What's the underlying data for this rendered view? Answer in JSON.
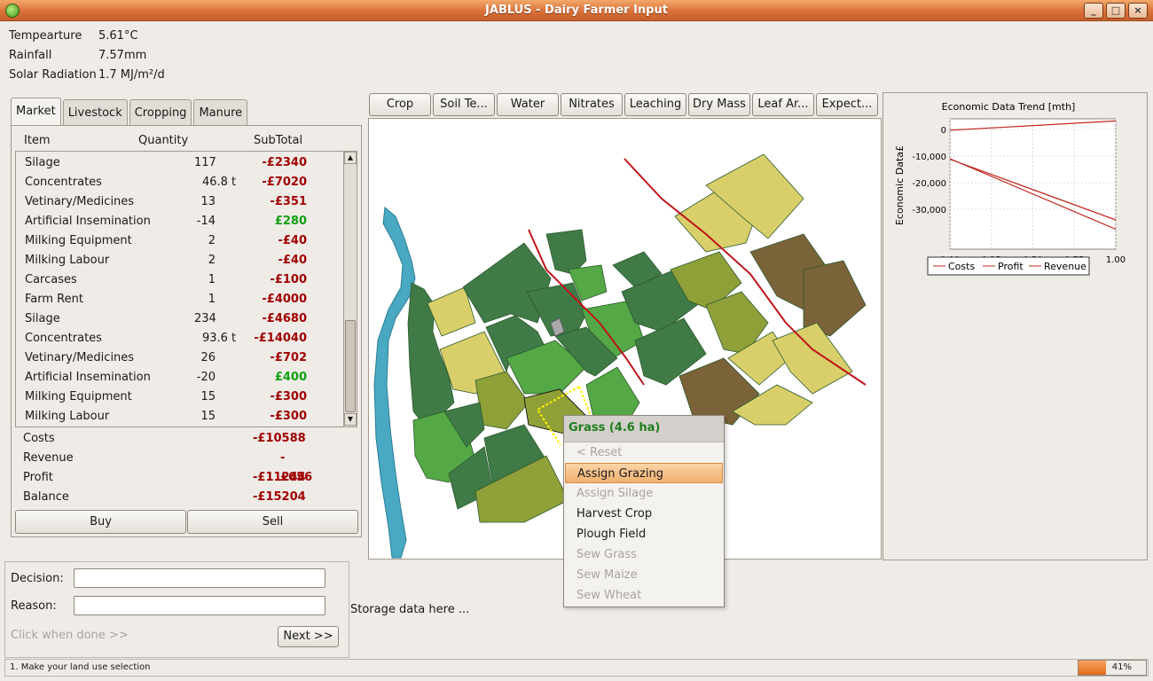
{
  "window": {
    "title": "JABLUS - Dairy Farmer Input",
    "buttons": [
      "_",
      "□",
      "×"
    ]
  },
  "weather": [
    {
      "label": "Tempearture",
      "value": "5.61°C"
    },
    {
      "label": "Rainfall",
      "value": "7.57mm"
    },
    {
      "label": "Solar Radiation",
      "value": "1.7  MJ/m²/d"
    }
  ],
  "tabs": [
    "Market",
    "Livestock",
    "Cropping",
    "Manure"
  ],
  "market": {
    "headers": {
      "item": "Item",
      "quantity": "Quantity",
      "subtotal": "SubTotal"
    },
    "rows": [
      {
        "item": "Silage",
        "qty": "117",
        "unit": "",
        "subtotal": "-£2340",
        "positive": false
      },
      {
        "item": "Concentrates",
        "qty": "46.8",
        "unit": "t",
        "subtotal": "-£7020",
        "positive": false
      },
      {
        "item": "Vetinary/Medicines",
        "qty": "13",
        "unit": "",
        "subtotal": "-£351",
        "positive": false
      },
      {
        "item": "Artificial Insemination",
        "qty": "-14",
        "unit": "",
        "subtotal": "£280",
        "positive": true
      },
      {
        "item": "Milking Equipment",
        "qty": "2",
        "unit": "",
        "subtotal": "-£40",
        "positive": false
      },
      {
        "item": "Milking Labour",
        "qty": "2",
        "unit": "",
        "subtotal": "-£40",
        "positive": false
      },
      {
        "item": "Carcases",
        "qty": "1",
        "unit": "",
        "subtotal": "-£100",
        "positive": false
      },
      {
        "item": "Farm Rent",
        "qty": "1",
        "unit": "",
        "subtotal": "-£4000",
        "positive": false
      },
      {
        "item": "Silage",
        "qty": "234",
        "unit": "",
        "subtotal": "-£4680",
        "positive": false
      },
      {
        "item": "Concentrates",
        "qty": "93.6",
        "unit": "t",
        "subtotal": "-£14040",
        "positive": false
      },
      {
        "item": "Vetinary/Medicines",
        "qty": "26",
        "unit": "",
        "subtotal": "-£702",
        "positive": false
      },
      {
        "item": "Artificial Insemination",
        "qty": "-20",
        "unit": "",
        "subtotal": "£400",
        "positive": true
      },
      {
        "item": "Milking Equipment",
        "qty": "15",
        "unit": "",
        "subtotal": "-£300",
        "positive": false
      },
      {
        "item": "Milking Labour",
        "qty": "15",
        "unit": "",
        "subtotal": "-£300",
        "positive": false
      }
    ],
    "summary": [
      {
        "label": "Costs",
        "value": "-£10588"
      },
      {
        "label": "Revenue",
        "value": "-£656"
      },
      {
        "label": "Profit",
        "value": "-£11244"
      },
      {
        "label": "Balance",
        "value": "-£15204"
      }
    ],
    "buy_label": "Buy",
    "sell_label": "Sell"
  },
  "toolbar": [
    "Crop",
    "Soil Te...",
    "Water",
    "Nitrates",
    "Leaching",
    "Dry Mass",
    "Leaf Ar...",
    "Expect..."
  ],
  "context_menu": {
    "title": "Grass (4.6 ha)",
    "items": [
      {
        "label": "< Reset",
        "enabled": false
      },
      {
        "label": "Assign Grazing",
        "enabled": true,
        "highlighted": true
      },
      {
        "label": "Assign Silage",
        "enabled": false
      },
      {
        "label": "Harvest Crop",
        "enabled": true
      },
      {
        "label": "Plough Field",
        "enabled": true
      },
      {
        "label": "Sew Grass",
        "enabled": false
      },
      {
        "label": "Sew Maize",
        "enabled": false
      },
      {
        "label": "Sew Wheat",
        "enabled": false
      }
    ]
  },
  "chart_data": {
    "type": "line",
    "title": "Economic Data Trend [mth]",
    "xlabel": "",
    "ylabel": "Economic Data£",
    "xlim": [
      0,
      1
    ],
    "ylim": [
      -45000,
      4000
    ],
    "xticks": [
      "0.00",
      "0.25",
      "0.50",
      "0.75",
      "1.00"
    ],
    "yticks": [
      {
        "value": 0,
        "label": "0"
      },
      {
        "value": -10000,
        "label": "-10,000"
      },
      {
        "value": -20000,
        "label": "-20,000"
      },
      {
        "value": -30000,
        "label": "-30,000"
      }
    ],
    "series": [
      {
        "name": "Costs",
        "x": [
          0,
          1
        ],
        "y": [
          -11000,
          -37500
        ]
      },
      {
        "name": "Profit",
        "x": [
          0,
          1
        ],
        "y": [
          -11200,
          -34000
        ]
      },
      {
        "name": "Revenue",
        "x": [
          0,
          1
        ],
        "y": [
          -300,
          3200
        ]
      }
    ],
    "line_color": "#c0281e",
    "legend_position": "bottom",
    "grid": true
  },
  "decision": {
    "decision_label": "Decision:",
    "reason_label": "Reason:",
    "decision_value": "",
    "reason_value": "",
    "hint": "Click when done >>",
    "next_label": "Next >>"
  },
  "storage_text": "Storage data here ...",
  "status": {
    "message": "1. Make your land use selection",
    "progress": 41,
    "progress_text": "41%"
  },
  "map_colors": {
    "dark": "#3f7a47",
    "mid": "#54a845",
    "light": "#d9cf6a",
    "olive": "#8fa039",
    "brown": "#7a6239",
    "water": "#4aa9c2",
    "road": "#c0141a"
  }
}
